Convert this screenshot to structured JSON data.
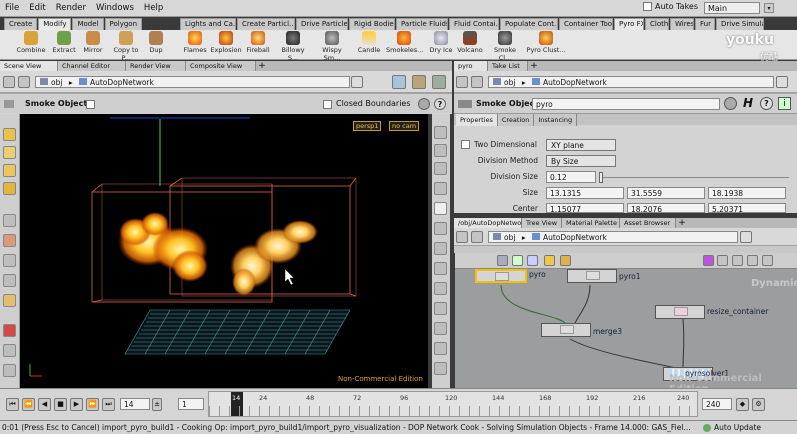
{
  "menu": {
    "items": [
      "File",
      "Edit",
      "Render",
      "Windows",
      "Help"
    ],
    "auto_takes": "Auto Takes",
    "desktop": "Main"
  },
  "shelf": {
    "left_tabs": [
      "Create",
      "Modify",
      "Model",
      "Polygon"
    ],
    "right_tabs": [
      "Lights and Ca...",
      "Create Particl...",
      "Drive Particles",
      "Rigid Bodies",
      "Particle Fluids",
      "Fluid Contai...",
      "Populate Cont...",
      "Container Tools",
      "Pyro FX",
      "Cloth",
      "Wires",
      "Fur",
      "Drive Simula..."
    ],
    "left_tools": [
      "Combine",
      "Extract",
      "Mirror",
      "Copy to P...",
      "Dup"
    ],
    "right_tools": [
      "Flames",
      "Explosion",
      "Fireball",
      "Billowy S...",
      "Wispy Sm...",
      "Candle",
      "Smokeles...",
      "Dry Ice",
      "Volcano",
      "Smoke Cl...",
      "Pyro Clust..."
    ],
    "watermark": "youku",
    "watermark_sub": "优酷"
  },
  "scene": {
    "tabs": [
      "Scene View",
      "Channel Editor",
      "Render View",
      "Composite View"
    ],
    "path": "obj",
    "network": "AutoDopNetwork",
    "object_label": "Smoke Object",
    "closed_boundaries": "Closed Boundaries",
    "camera": "persp1",
    "cam2": "no cam",
    "edition": "Non-Commercial Edition"
  },
  "params": {
    "tabs": [
      "pyro",
      "Take List"
    ],
    "path": "obj",
    "network": "AutoDopNetwork",
    "type_label": "Smoke Object",
    "node_name": "pyro",
    "subtabs": [
      "Properties",
      "Creation",
      "Instancing"
    ],
    "two_dim": "Two Dimensional",
    "plane": "XY plane",
    "division_method_label": "Division Method",
    "division_method": "By Size",
    "division_size_label": "Division Size",
    "division_size": "0.12",
    "size_label": "Size",
    "size": [
      "13.1315",
      "31.5559",
      "18.1938"
    ],
    "center_label": "Center",
    "center": [
      "1.15077",
      "18.2076",
      "5.20371"
    ]
  },
  "network": {
    "tabs": [
      "/obj/AutoDopNetwork",
      "Tree View",
      "Material Palette",
      "Asset Browser"
    ],
    "path": "obj",
    "name": "AutoDopNetwork",
    "nodes": [
      "pyro",
      "pyro1",
      "merge3",
      "resize_container",
      "pyrosolver1"
    ],
    "bg_label": "Dynamics",
    "edition": "Non-Commercial Edition"
  },
  "timeline": {
    "frame": "14",
    "start": "1",
    "ticks": [
      "14",
      "24",
      "48",
      "72",
      "96",
      "120",
      "144",
      "168",
      "192",
      "216",
      "240"
    ],
    "end": "240",
    "auto_update": "Auto Update"
  },
  "status": {
    "text": "0:01 (Press Esc to Cancel) import_pyro_build1 - Cooking Op:  import_pyro_build1/import_pyro_visualization - DOP Network Cook - Solving Simulation Objects - Frame 14.000: GAS_Fiel..."
  },
  "colors": {
    "fire_core": "#fff3a0",
    "fire_mid": "#ffb000",
    "fire_edge": "#d85a00",
    "bbox": "#d9644f",
    "grid": "#5fb1c0",
    "selected_node": "#f2c200"
  }
}
